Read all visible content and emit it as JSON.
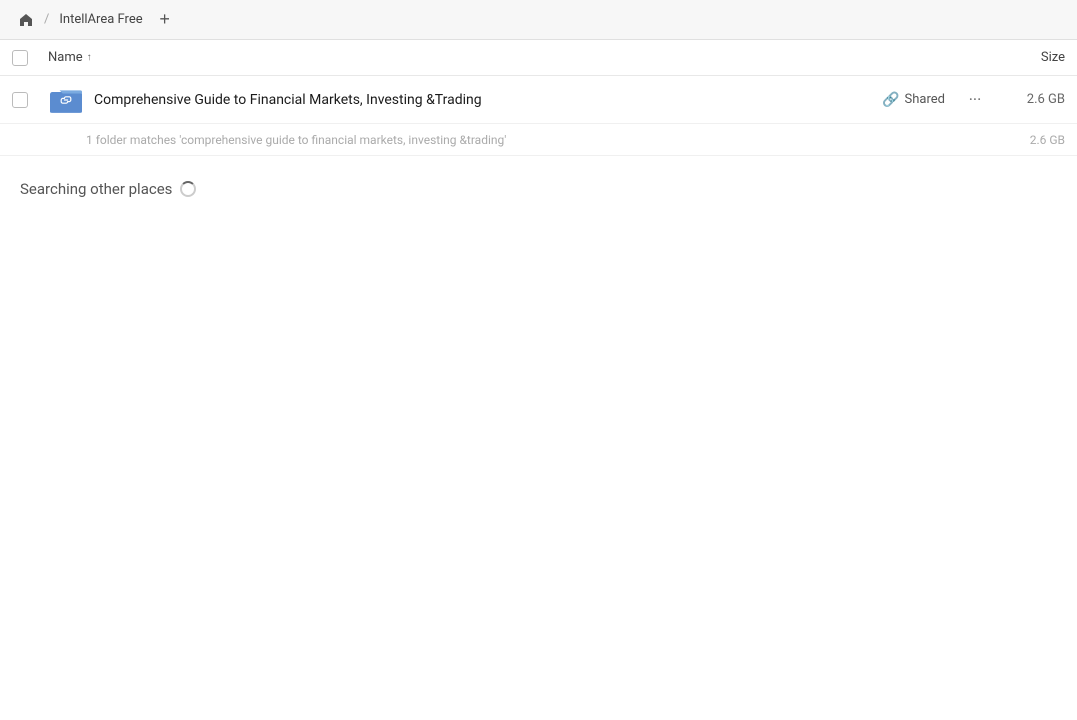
{
  "topbar": {
    "home_icon": "🏠",
    "breadcrumb_app": "IntellArea Free",
    "add_tab_label": "+"
  },
  "columns": {
    "name_label": "Name",
    "sort_indicator": "↑",
    "size_label": "Size"
  },
  "file_row": {
    "name": "Comprehensive Guide to Financial Markets, Investing &Trading",
    "shared_label": "Shared",
    "size": "2.6 GB",
    "more_icon": "•••"
  },
  "match_info": {
    "text": "1 folder matches 'comprehensive guide to financial markets, investing &trading'",
    "size": "2.6 GB"
  },
  "searching_section": {
    "label": "Searching other places"
  }
}
